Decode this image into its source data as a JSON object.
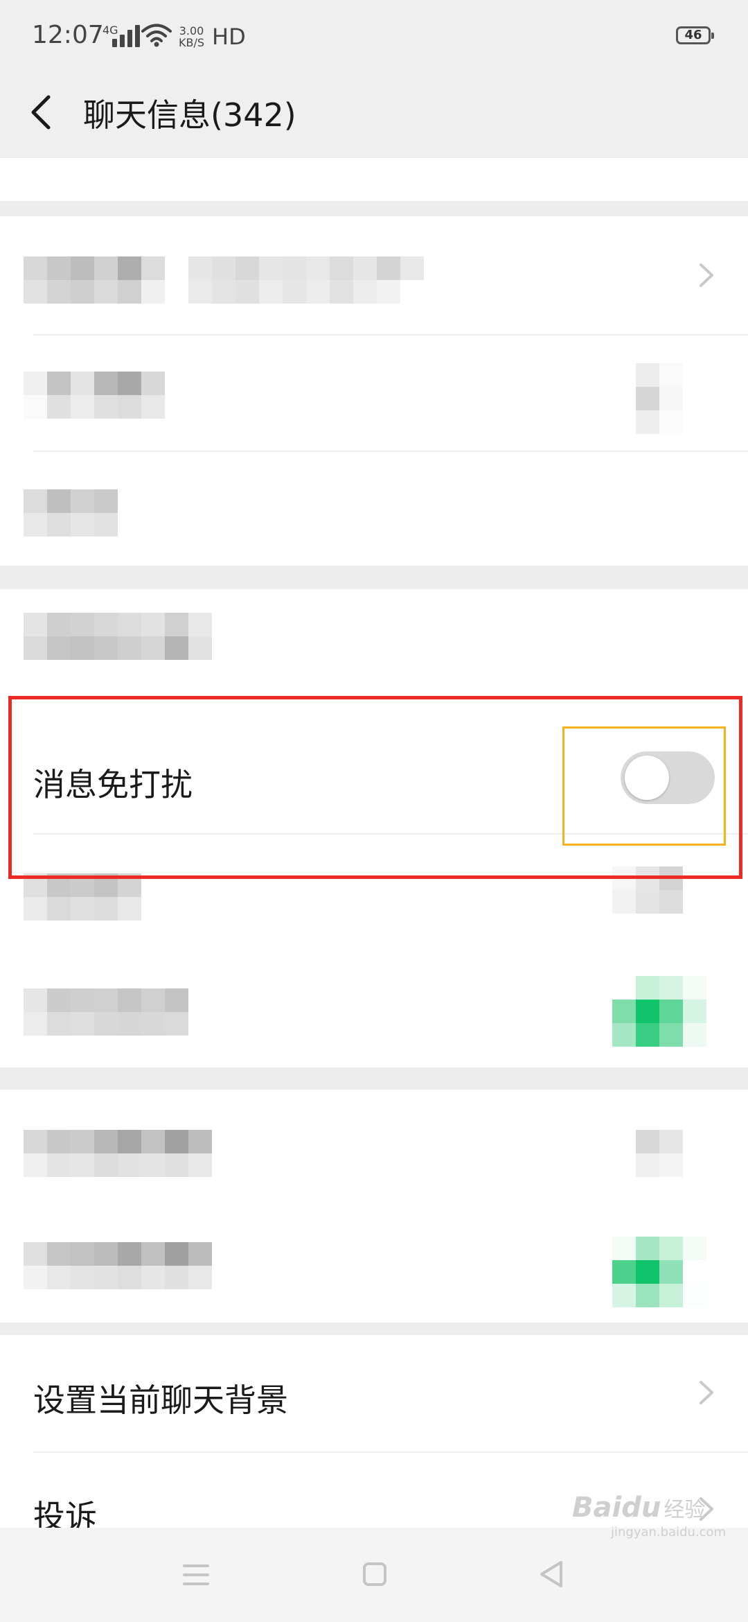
{
  "status_bar": {
    "time": "12:07",
    "network": "4G",
    "speed_value": "3.00",
    "speed_unit": "KB/S",
    "hd": "HD",
    "battery": "46"
  },
  "header": {
    "title": "聊天信息(342)"
  },
  "rows": {
    "do_not_disturb": "消息免打扰",
    "chat_background": "设置当前聊天背景",
    "complain": "投诉"
  },
  "do_not_disturb_toggle": {
    "on": false
  },
  "colors": {
    "highlight_red": "#ee2a24",
    "highlight_yellow": "#f8b21c",
    "toggle_off": "#d9d9d9",
    "accent_green": "#07c160"
  },
  "watermark": {
    "brand": "Bai",
    "brand_suffix": "du",
    "cn": "经验",
    "url": "jingyan.baidu.com"
  }
}
